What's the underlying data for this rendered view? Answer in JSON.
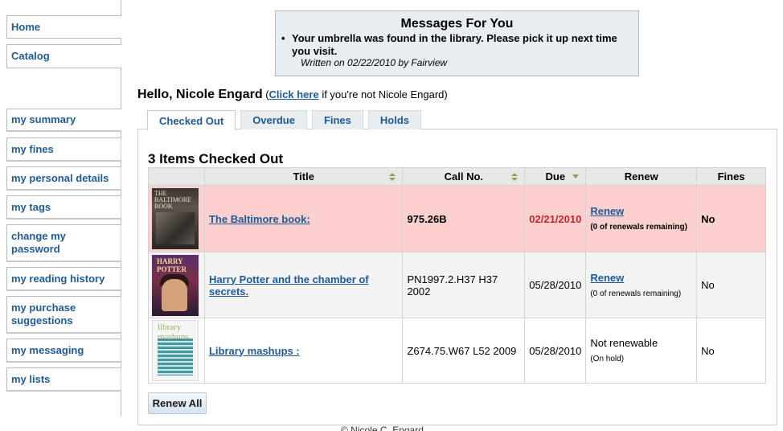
{
  "nav": {
    "home": "Home",
    "catalog": "Catalog",
    "items": [
      {
        "label": "my summary",
        "active": true
      },
      {
        "label": "my fines"
      },
      {
        "label": "my personal details"
      },
      {
        "label": "my tags"
      },
      {
        "label": "change my password"
      },
      {
        "label": "my reading history"
      },
      {
        "label": "my purchase suggestions"
      },
      {
        "label": "my messaging"
      },
      {
        "label": "my lists"
      }
    ]
  },
  "messages": {
    "title": "Messages For You",
    "text": "Your umbrella was found in the library. Please pick it up next time you visit.",
    "written": "Written on 02/22/2010 by Fairview"
  },
  "greeting": {
    "hello": "Hello, Nicole Engard",
    "open_paren": " (",
    "link": "Click here",
    "suffix": " if you're not Nicole Engard)"
  },
  "tabs": [
    "Checked Out",
    "Overdue",
    "Fines",
    "Holds"
  ],
  "checked_out": {
    "heading": "3 Items Checked Out",
    "columns": [
      "Title",
      "Call No.",
      "Due",
      "Renew",
      "Fines"
    ],
    "rows": [
      {
        "cover_text": "THE BALTIMORE BOOK",
        "title": "The Baltimore book:",
        "call_no": "975.26B",
        "due": "02/21/2010",
        "renew_link": "Renew",
        "renew_note": "(0 of renewals remaining)",
        "fines": "No",
        "overdue": true
      },
      {
        "cover_text": "HARRY POTTER",
        "title": "Harry Potter and the chamber of secrets.",
        "call_no": "PN1997.2.H37 H37 2002",
        "due": "05/28/2010",
        "renew_link": "Renew",
        "renew_note": "(0 of renewals remaining)",
        "fines": "No"
      },
      {
        "cover_text": "library mashups",
        "title": "Library mashups :",
        "call_no": "Z674.75.W67 L52 2009",
        "due": "05/28/2010",
        "renew_status": "Not renewable",
        "renew_note": "(On hold)",
        "fines": "No"
      }
    ],
    "renew_all": "Renew All"
  },
  "footer": "© Nicole C. Engard",
  "colors": {
    "link": "#1e5a96",
    "overdue_row": "#fdd0d0",
    "overdue_text": "#cc2222"
  }
}
